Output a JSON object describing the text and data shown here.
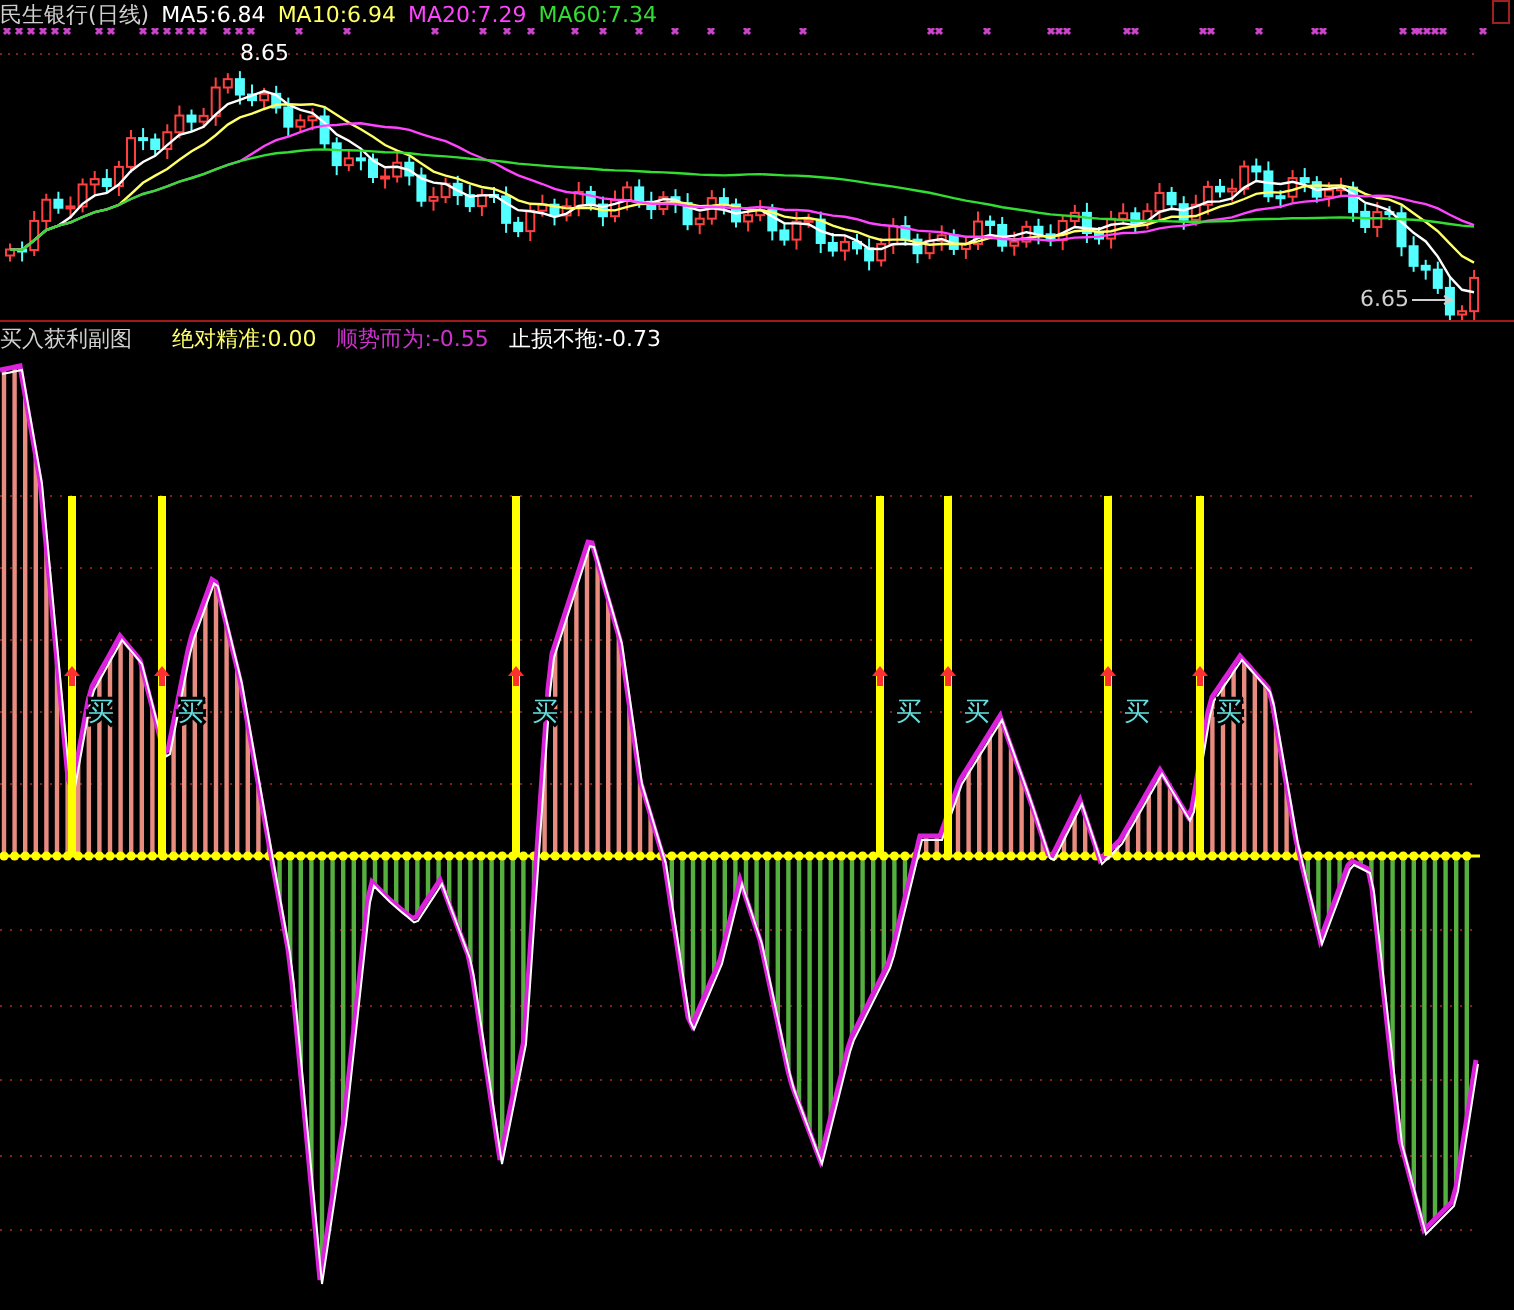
{
  "main_chart": {
    "title": "民生银行(日线)",
    "indicators": [
      {
        "label": "MA5:6.84",
        "color": "#ffffff"
      },
      {
        "label": "MA10:6.94",
        "color": "#ffff66"
      },
      {
        "label": "MA20:7.29",
        "color": "#ff44ff"
      },
      {
        "label": "MA60:7.34",
        "color": "#33dd33"
      }
    ],
    "high_label": "8.65",
    "low_label": "6.65"
  },
  "sub_chart": {
    "title": "买入获利副图",
    "indicators": [
      {
        "label": "绝对精准:0.00",
        "color": "#ffff66"
      },
      {
        "label": "顺势而为:-0.55",
        "color": "#cc33cc"
      },
      {
        "label": "止损不拖:-0.73",
        "color": "#ffffff"
      }
    ],
    "signals": [
      {
        "label": "买"
      },
      {
        "label": "买"
      },
      {
        "label": "买"
      },
      {
        "label": "买"
      },
      {
        "label": "买"
      },
      {
        "label": "买"
      },
      {
        "label": "买"
      }
    ]
  }
}
